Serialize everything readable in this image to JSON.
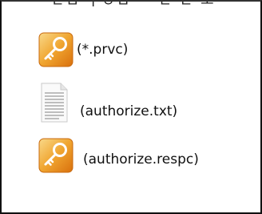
{
  "header": {
    "cutoff_text": "ㄷㅁ ㅏㅇㅁ ㅡ  ㅌ ㅌ ㅗ"
  },
  "files": [
    {
      "icon": "key-file-icon",
      "label": "(*.prvc)"
    },
    {
      "icon": "text-document-icon",
      "label": "(authorize.txt)"
    },
    {
      "icon": "key-file-icon",
      "label": "(authorize.respc)"
    }
  ],
  "colors": {
    "key_gradient_light": "#f7c873",
    "key_gradient_dark": "#e07b12",
    "border": "#111111"
  }
}
